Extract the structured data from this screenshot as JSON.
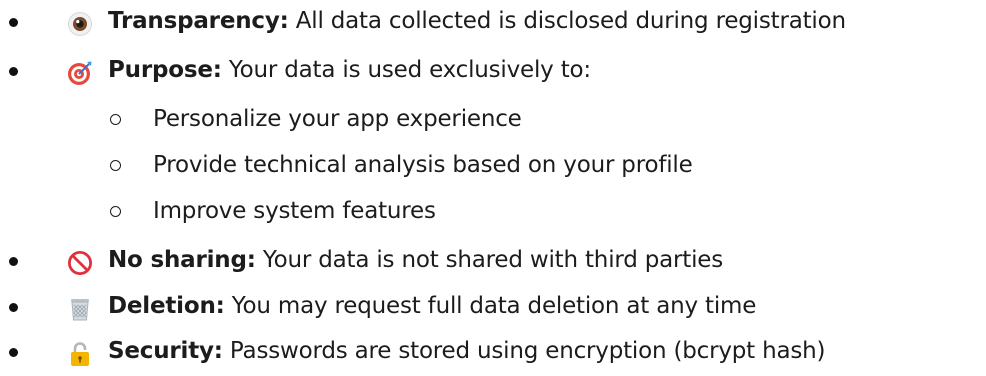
{
  "items": [
    {
      "icon": "eye-icon",
      "label": "Transparency:",
      "text": " All data collected is disclosed during registration"
    },
    {
      "icon": "target-dart-icon",
      "label": "Purpose:",
      "text": " Your data is used exclusively to:",
      "subitems": [
        "Personalize your app experience",
        "Provide technical analysis based on your profile",
        "Improve system features"
      ]
    },
    {
      "icon": "prohibited-icon",
      "label": "No sharing:",
      "text": " Your data is not shared with third parties"
    },
    {
      "icon": "wastebasket-icon",
      "label": "Deletion:",
      "text": " You may request full data deletion at any time"
    },
    {
      "icon": "lock-icon",
      "label": "Security:",
      "text": " Passwords are stored using encryption (bcrypt hash)"
    }
  ],
  "colors": {
    "text": "#1c1c1c",
    "prohibited": "#e0323c",
    "lock": "#f4b400",
    "target": "#e8483a"
  }
}
